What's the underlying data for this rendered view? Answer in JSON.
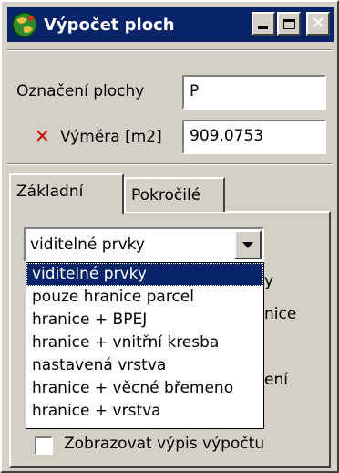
{
  "window": {
    "title": "Výpočet ploch"
  },
  "form": {
    "name_label": "Označení plochy",
    "name_value": "P",
    "area_label": "Výměra [m2]",
    "area_value": "909.0753"
  },
  "tabs": [
    {
      "label": "Základní",
      "active": true
    },
    {
      "label": "Pokročilé",
      "active": false
    }
  ],
  "combo": {
    "selected": "viditelné prvky",
    "options": [
      "viditelné prvky",
      "pouze hranice parcel",
      "hranice + BPEJ",
      "hranice + vnitřní kresba",
      "nastavená vrstva",
      "hranice + věcné břemeno",
      "hranice + vrstva"
    ]
  },
  "partially_hidden": {
    "text_1": "y",
    "text_2": "nice",
    "text_3": "ení"
  },
  "checkbox": {
    "label": "Zobrazovat výpis výpočtu",
    "checked": false
  },
  "colors": {
    "titlebar": "#0a246a",
    "face": "#d4d0c8",
    "highlight": "#0a246a",
    "error_x": "#c00000"
  }
}
